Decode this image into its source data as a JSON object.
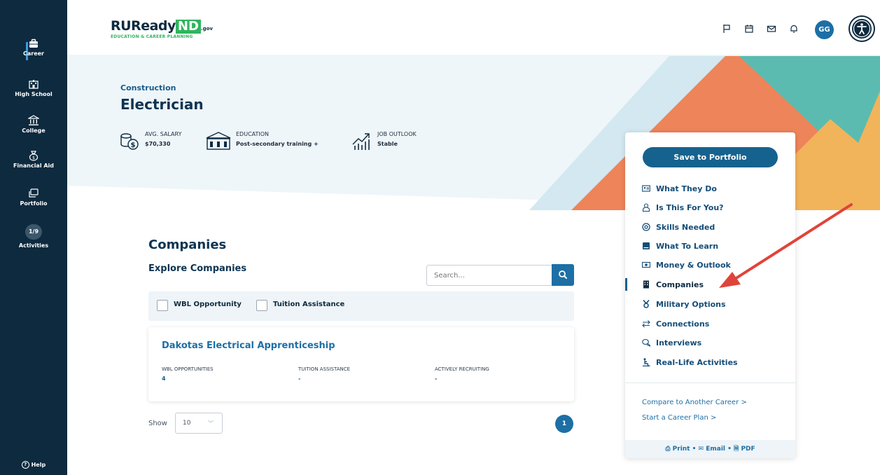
{
  "sidebar": {
    "items": [
      {
        "label": "Career",
        "icon": "briefcase-icon"
      },
      {
        "label": "High School",
        "icon": "school-icon"
      },
      {
        "label": "College",
        "icon": "institution-icon"
      },
      {
        "label": "Financial Aid",
        "icon": "money-bag-icon"
      },
      {
        "label": "Portfolio",
        "icon": "portfolio-icon"
      },
      {
        "label": "Activities",
        "badge": "1/9"
      }
    ],
    "help": "Help"
  },
  "header": {
    "logo_ru": "RUReady",
    "logo_nd": "ND",
    "logo_gov": ".gov",
    "logo_tagline": "EDUCATION & CAREER PLANNING",
    "avatar": "GG",
    "icons": [
      "flag-icon",
      "calendar-icon",
      "mail-icon",
      "bell-icon",
      "accessibility-icon"
    ]
  },
  "career": {
    "category": "Construction",
    "title": "Electrician",
    "stats": [
      {
        "key": "AVG. SALARY",
        "value": "$70,330",
        "icon": "salary-icon"
      },
      {
        "key": "EDUCATION",
        "value": "Post-secondary training +",
        "icon": "education-icon"
      },
      {
        "key": "JOB OUTLOOK",
        "value": "Stable",
        "icon": "outlook-icon"
      }
    ]
  },
  "companies": {
    "title": "Companies",
    "subtitle": "Explore Companies",
    "search_placeholder": "Search...",
    "filters": [
      "WBL Opportunity",
      "Tuition Assistance"
    ],
    "cards": [
      {
        "name": "Dakotas Electrical Apprenticeship",
        "cols": [
          {
            "key": "WBL OPPORTUNITIES",
            "value": "4"
          },
          {
            "key": "TUITION ASSISTANCE",
            "value": "-"
          },
          {
            "key": "ACTIVELY RECRUITING",
            "value": "-"
          }
        ]
      }
    ],
    "show_label": "Show",
    "show_value": "10",
    "page": "1"
  },
  "panel": {
    "save_button": "Save to Portfolio",
    "nav": [
      {
        "label": "What They Do",
        "icon": "id-card-icon"
      },
      {
        "label": "Is This For You?",
        "icon": "person-icon"
      },
      {
        "label": "Skills Needed",
        "icon": "target-icon"
      },
      {
        "label": "What To Learn",
        "icon": "book-icon"
      },
      {
        "label": "Money & Outlook",
        "icon": "money-icon"
      },
      {
        "label": "Companies",
        "icon": "building-icon",
        "active": true
      },
      {
        "label": "Military Options",
        "icon": "medal-icon"
      },
      {
        "label": "Connections",
        "icon": "arrows-icon"
      },
      {
        "label": "Interviews",
        "icon": "chat-icon"
      },
      {
        "label": "Real-Life Activities",
        "icon": "activity-icon"
      }
    ],
    "links": [
      "Compare to Another Career >",
      "Start a Career Plan >"
    ],
    "footer": {
      "print": "Print",
      "email": "Email",
      "pdf": "PDF",
      "sep": "•"
    }
  },
  "colors": {
    "sidebar_bg": "#0d2a3f",
    "accent_blue": "#1d6fa5",
    "hero_bg": "#eef6fa",
    "teal": "#5bbbb0",
    "orange": "#ee845a",
    "yellow": "#f2b45a",
    "annotation_arrow": "#e0433a"
  }
}
